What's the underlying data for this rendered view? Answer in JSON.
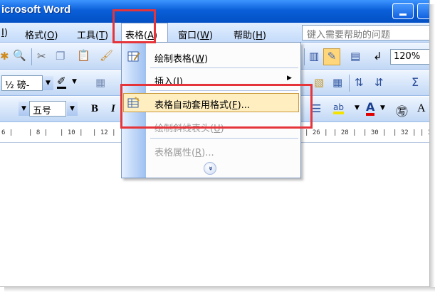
{
  "window": {
    "title": "icrosoft Word"
  },
  "menubar": {
    "items": [
      {
        "label": "",
        "accel": "I",
        "suffix": ")"
      },
      {
        "label": "格式(",
        "accel": "O",
        "suffix": ")"
      },
      {
        "label": "工具(",
        "accel": "T",
        "suffix": ")"
      },
      {
        "label": "表格(",
        "accel": "A",
        "suffix": ")"
      },
      {
        "label": "窗口(",
        "accel": "W",
        "suffix": ")"
      },
      {
        "label": "帮助(",
        "accel": "H",
        "suffix": ")"
      }
    ],
    "help_placeholder": "键入需要帮助的问题"
  },
  "toolbar": {
    "zoom": "120%",
    "font_size_partial": "½ 磅-",
    "font_size": "五号",
    "bold": "B",
    "italic_partial": "I",
    "circled_char": "㊢",
    "a_label": "A"
  },
  "ruler": {
    "left_ticks": [
      "6 |",
      "| 8 |",
      "| 10 |",
      "| 12 |"
    ],
    "right_ticks": [
      "| 26 |",
      "| 28 |",
      "| 30 |",
      "| 32 |",
      "| 3"
    ]
  },
  "table_menu": {
    "items": [
      {
        "label": "绘制表格(",
        "accel": "W",
        "suffix": ")",
        "enabled": true
      },
      {
        "label": "插入(",
        "accel": "I",
        "suffix": ")",
        "enabled": true,
        "submenu": true
      },
      {
        "label": "表格自动套用格式(",
        "accel": "F",
        "suffix": ")...",
        "enabled": true,
        "highlighted": true
      },
      {
        "label": "绘制斜线表头(",
        "accel": "U",
        "suffix": ")",
        "enabled": false
      },
      {
        "label": "表格属性(",
        "accel": "R",
        "suffix": ")...",
        "enabled": false
      }
    ],
    "expand_glyph": "»"
  },
  "colors": {
    "titlebar": "#0a5fd8",
    "menu_highlight": "#ffeebf",
    "annotation_red": "#e5343a"
  }
}
